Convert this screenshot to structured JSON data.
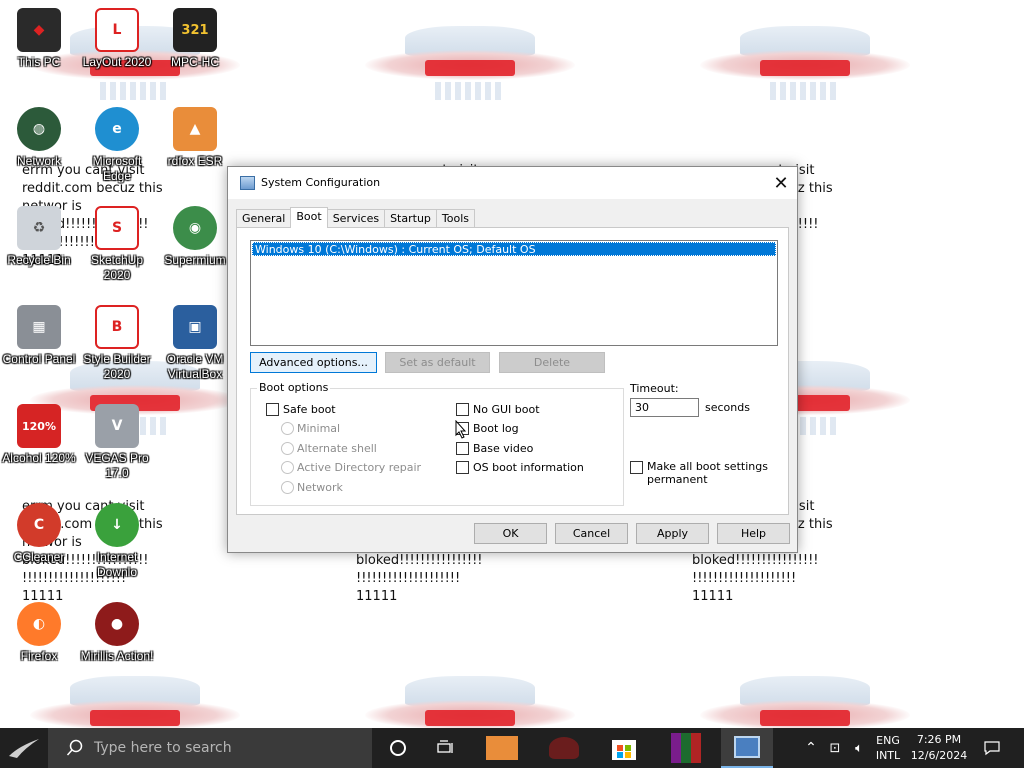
{
  "desktop": {
    "icons": [
      {
        "label": "This PC",
        "icon": "rog-laptop-icon"
      },
      {
        "label": "LayOut 2020",
        "icon": "layout-icon"
      },
      {
        "label": "MPC-HC",
        "icon": "mpc-hc-icon"
      },
      {
        "label": "Network",
        "icon": "network-globe-icon"
      },
      {
        "label": "Microsoft Edge",
        "icon": "edge-icon"
      },
      {
        "label": "rdfox ESR",
        "icon": "firefox-esr-icon"
      },
      {
        "label": "Recycle Bin",
        "icon": "recycle-bin-icon"
      },
      {
        "label": "SketchUp 2020",
        "icon": "sketchup-icon"
      },
      {
        "label": "Supermium",
        "icon": "supermium-icon"
      },
      {
        "label": "Control Panel",
        "icon": "control-panel-icon"
      },
      {
        "label": "Style Builder 2020",
        "icon": "style-builder-icon"
      },
      {
        "label": "Oracle VM VirtualBox",
        "icon": "virtualbox-icon"
      },
      {
        "label": "Alcohol 120%",
        "icon": "alcohol-icon"
      },
      {
        "label": "VEGAS Pro 17.0",
        "icon": "vegas-icon"
      },
      {
        "label": "CCleaner",
        "icon": "ccleaner-icon"
      },
      {
        "label": "Internet Downlo",
        "icon": "idm-icon"
      },
      {
        "label": "Firefox",
        "icon": "firefox-icon"
      },
      {
        "label": "Mirillis Action!",
        "icon": "mirillis-icon"
      }
    ],
    "wallpaper_text": [
      "errm you cant visit",
      "reddit.com becuz this",
      "networ is",
      "bloked!!!!!!!!!!!!!!!!",
      "!!!!!!!!!!!!!!!!!!!!",
      "11111"
    ]
  },
  "dialog": {
    "title": "System Configuration",
    "close_glyph": "✕",
    "tabs": [
      "General",
      "Boot",
      "Services",
      "Startup",
      "Tools"
    ],
    "active_tab": "Boot",
    "os_entries": [
      "Windows 10 (C:\\Windows) : Current OS; Default OS"
    ],
    "buttons": {
      "advanced": "Advanced options...",
      "set_default": "Set as default",
      "delete": "Delete",
      "ok": "OK",
      "cancel": "Cancel",
      "apply": "Apply",
      "help": "Help"
    },
    "boot_options": {
      "legend": "Boot options",
      "safe_boot": "Safe boot",
      "minimal": "Minimal",
      "alternate_shell": "Alternate shell",
      "ad_repair": "Active Directory repair",
      "network": "Network",
      "no_gui_boot": "No GUI boot",
      "boot_log": "Boot log",
      "base_video": "Base video",
      "os_boot_info": "OS boot information"
    },
    "timeout": {
      "label": "Timeout:",
      "value": "30",
      "unit": "seconds"
    },
    "make_permanent_1": "Make all boot settings",
    "make_permanent_2": "permanent"
  },
  "taskbar": {
    "search_placeholder": "Type here to search",
    "lang_1": "ENG",
    "lang_2": "INTL",
    "time": "7:26 PM",
    "date": "12/6/2024"
  },
  "colors": {
    "accent": "#0078d7",
    "taskbar": "#202020"
  }
}
